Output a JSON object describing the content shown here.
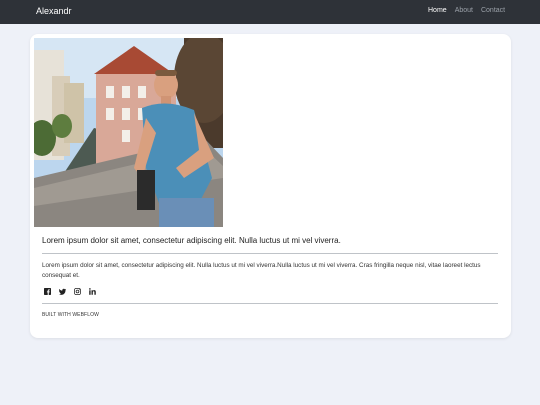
{
  "nav": {
    "brand": "Alexandr",
    "links": [
      {
        "label": "Home",
        "active": true
      },
      {
        "label": "About",
        "active": false
      },
      {
        "label": "Contact",
        "active": false
      }
    ]
  },
  "content": {
    "photo_icon": "profile-photo",
    "headline": "Lorem ipsum dolor sit amet, consectetur adipiscing elit. Nulla luctus ut mi vel viverra.",
    "body": "Lorem ipsum dolor sit amet, consectetur adipiscing elit. Nulla luctus ut mi vel viverra.Nulla luctus ut mi vel viverra. Cras fringilla neque nisl, vitae laoreet lectus consequat et.",
    "social": [
      {
        "icon": "facebook-icon"
      },
      {
        "icon": "twitter-icon"
      },
      {
        "icon": "instagram-icon"
      },
      {
        "icon": "linkedin-icon"
      }
    ],
    "footer": "BUILT WITH WEBFLOW"
  },
  "colors": {
    "navbar": "#2e3238",
    "page_background": "#eef1f8",
    "card": "#ffffff"
  }
}
